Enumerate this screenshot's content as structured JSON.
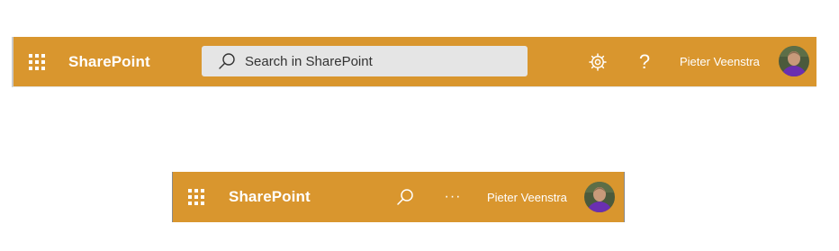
{
  "theme": {
    "suite_bar_color": "#D9962E",
    "text_color": "#FFFFFF",
    "search_bg": "#E5E5E5"
  },
  "wide_header": {
    "waffle_icon": "app-launcher-icon",
    "brand": "SharePoint",
    "search": {
      "icon": "search-icon",
      "placeholder": "Search in SharePoint"
    },
    "settings_icon": "gear-icon",
    "help_label": "?",
    "user_name": "Pieter Veenstra",
    "avatar_icon": "avatar"
  },
  "narrow_header": {
    "waffle_icon": "app-launcher-icon",
    "brand": "SharePoint",
    "search_icon": "search-icon",
    "more_label": "···",
    "user_name": "Pieter Veenstra",
    "avatar_icon": "avatar"
  }
}
